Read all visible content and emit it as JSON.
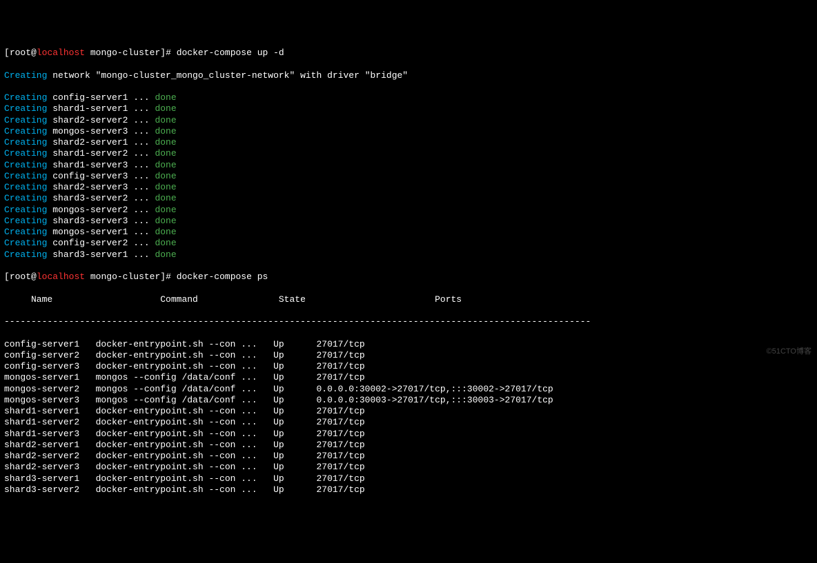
{
  "prompt1": {
    "user": "root",
    "at": "@",
    "host": "localhost",
    "path": " mongo-cluster",
    "hash": "]# ",
    "command": "docker-compose up -d"
  },
  "network_line": {
    "creating": "Creating",
    "text": " network \"mongo-cluster_mongo_cluster-network\" with driver \"bridge\""
  },
  "creating_lines": [
    {
      "label": "Creating",
      "name": " config-server1 ... ",
      "status": "done"
    },
    {
      "label": "Creating",
      "name": " shard1-server1 ... ",
      "status": "done"
    },
    {
      "label": "Creating",
      "name": " shard2-server2 ... ",
      "status": "done"
    },
    {
      "label": "Creating",
      "name": " mongos-server3 ... ",
      "status": "done"
    },
    {
      "label": "Creating",
      "name": " shard2-server1 ... ",
      "status": "done"
    },
    {
      "label": "Creating",
      "name": " shard1-server2 ... ",
      "status": "done"
    },
    {
      "label": "Creating",
      "name": " shard1-server3 ... ",
      "status": "done"
    },
    {
      "label": "Creating",
      "name": " config-server3 ... ",
      "status": "done"
    },
    {
      "label": "Creating",
      "name": " shard2-server3 ... ",
      "status": "done"
    },
    {
      "label": "Creating",
      "name": " shard3-server2 ... ",
      "status": "done"
    },
    {
      "label": "Creating",
      "name": " mongos-server2 ... ",
      "status": "done"
    },
    {
      "label": "Creating",
      "name": " shard3-server3 ... ",
      "status": "done"
    },
    {
      "label": "Creating",
      "name": " mongos-server1 ... ",
      "status": "done"
    },
    {
      "label": "Creating",
      "name": " config-server2 ... ",
      "status": "done"
    },
    {
      "label": "Creating",
      "name": " shard3-server1 ... ",
      "status": "done"
    }
  ],
  "prompt2": {
    "user": "root",
    "at": "@",
    "host": "localhost",
    "path": " mongo-cluster",
    "hash": "]# ",
    "command": "docker-compose ps"
  },
  "ps_header": "     Name                    Command               State                        Ports                     ",
  "ps_sep": "-------------------------------------------------------------------------------------------------------------",
  "ps_rows": [
    "config-server1   docker-entrypoint.sh --con ...   Up      27017/tcp",
    "config-server2   docker-entrypoint.sh --con ...   Up      27017/tcp",
    "config-server3   docker-entrypoint.sh --con ...   Up      27017/tcp",
    "mongos-server1   mongos --config /data/conf ...   Up      27017/tcp",
    "mongos-server2   mongos --config /data/conf ...   Up      0.0.0.0:30002->27017/tcp,:::30002->27017/tcp",
    "mongos-server3   mongos --config /data/conf ...   Up      0.0.0.0:30003->27017/tcp,:::30003->27017/tcp",
    "shard1-server1   docker-entrypoint.sh --con ...   Up      27017/tcp",
    "shard1-server2   docker-entrypoint.sh --con ...   Up      27017/tcp",
    "shard1-server3   docker-entrypoint.sh --con ...   Up      27017/tcp",
    "shard2-server1   docker-entrypoint.sh --con ...   Up      27017/tcp",
    "shard2-server2   docker-entrypoint.sh --con ...   Up      27017/tcp",
    "shard2-server3   docker-entrypoint.sh --con ...   Up      27017/tcp",
    "shard3-server1   docker-entrypoint.sh --con ...   Up      27017/tcp",
    "shard3-server2   docker-entrypoint.sh --con ...   Up      27017/tcp"
  ],
  "watermark": "©51CTO博客"
}
